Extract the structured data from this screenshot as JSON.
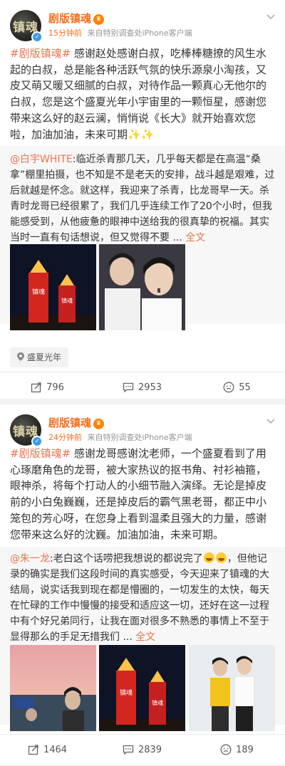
{
  "posts": [
    {
      "username": "剧版镇魂",
      "avatar_text": "镇魂",
      "time": "15分钟前",
      "source": "来自特别调查处iPhone客户端",
      "hashtag": "#剧版镇魂#",
      "text": "感谢赵处感谢白叔，吃棒棒糖撩的风生水起的白叔，总是能各种活跃气氛的快乐源泉小淘孩，又皮又萌又暖又细腻的白叔，对待作品一颗真心无他尔的白叔，您是这个盛夏光年小宇宙里的一颗恒星，感谢您带来这么好的赵云澜，悄悄说《长大》就开始喜欢您啦，加油加油，未来可期",
      "sparkles": "✨✨",
      "repost_user": "@白宇WHITE",
      "repost_text": ":临近杀青那几天，几乎每天都是在高温“桑拿”棚里拍摄，也不知是不是老天的安排，战斗越是艰难，过后就越是怀念。就这样，我迎来了杀青，比龙哥早一天。杀青时龙哥已经很累了，我们几乎连续工作了20个小时，但我能感受到，从他疲惫的眼神中送给我的很真挚的祝福。其实当时一直有句话想说，但又觉得不要 ...",
      "more": "全文",
      "image_texts": [
        "镇魂",
        "镇魂",
        "镇魂"
      ],
      "topic_tag": "盛夏光年",
      "reposts": "796",
      "comments": "2953",
      "likes": "55"
    },
    {
      "username": "剧版镇魂",
      "avatar_text": "镇魂",
      "time": "24分钟前",
      "source": "来自特别调查处iPhone客户端",
      "hashtag": "#剧版镇魂#",
      "text": "感谢龙哥感谢沈老师，一个盛夏看到了用心琢磨角色的龙哥，被大家热议的抠书角、衬衫袖箍，眼神杀，将每个打动人的小细节融入演绎。无论是掉皮前的小白兔巍巍，还是掉皮后的霸气黑老哥，都正中小笼包的芳心呀，在您身上看到温柔且强大的力量，感谢您带来这么好的沈巍。加油加油，未来可期。",
      "repost_user": "@朱一龙",
      "repost_text_a": ":老白这个话唠把我想说的都说完了",
      "repost_text_b": "，但他记录的确实是我们这段时间的真实感受，今天迎来了镇魂的大结局，说实话我到现在都是懵圈的，一切发生的太快，每天在忙碌的工作中慢慢的接受和适应这一切，还好在这一过程中有个好兄弟同行，让我在面对很多不熟悉的事情上不至于显得那么的手足无措我们 ...",
      "more": "全文",
      "image_texts": [
        "镇魂",
        "镇魂"
      ],
      "reposts": "1464",
      "comments": "2839",
      "likes": "189"
    }
  ],
  "colors": {
    "accent": "#eb7350",
    "username": "#f56e1d",
    "verified": "#3d9ae8",
    "vip": "#ff8200"
  },
  "icons": [
    "repost-icon",
    "comment-icon",
    "like-icon",
    "chevron-down-icon",
    "location-icon"
  ]
}
